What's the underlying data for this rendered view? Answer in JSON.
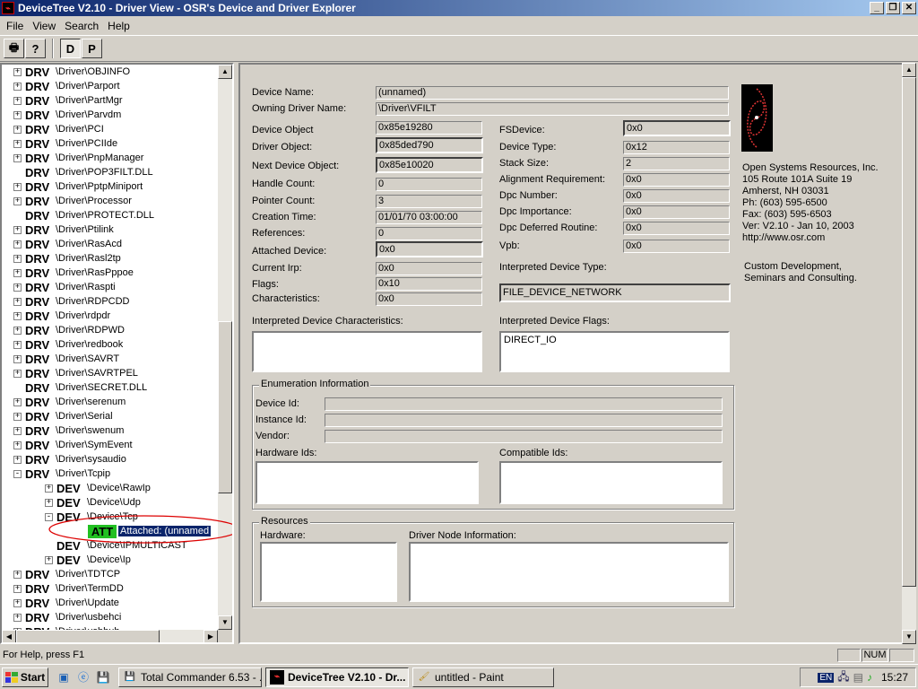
{
  "window": {
    "title": "DeviceTree V2.10 - Driver View - OSR's Device and Driver Explorer"
  },
  "menu": [
    "File",
    "View",
    "Search",
    "Help"
  ],
  "toolbar": {
    "d_label": "D",
    "p_label": "P"
  },
  "tree": {
    "items": [
      {
        "tag": "DRV",
        "name": "\\Driver\\OBJINFO",
        "indent": 0,
        "exp": "+"
      },
      {
        "tag": "DRV",
        "name": "\\Driver\\Parport",
        "indent": 0,
        "exp": "+"
      },
      {
        "tag": "DRV",
        "name": "\\Driver\\PartMgr",
        "indent": 0,
        "exp": "+"
      },
      {
        "tag": "DRV",
        "name": "\\Driver\\Parvdm",
        "indent": 0,
        "exp": "+"
      },
      {
        "tag": "DRV",
        "name": "\\Driver\\PCI",
        "indent": 0,
        "exp": "+"
      },
      {
        "tag": "DRV",
        "name": "\\Driver\\PCIIde",
        "indent": 0,
        "exp": "+"
      },
      {
        "tag": "DRV",
        "name": "\\Driver\\PnpManager",
        "indent": 0,
        "exp": "+"
      },
      {
        "tag": "DRV",
        "name": "\\Driver\\POP3FILT.DLL",
        "indent": 0,
        "exp": ""
      },
      {
        "tag": "DRV",
        "name": "\\Driver\\PptpMiniport",
        "indent": 0,
        "exp": "+"
      },
      {
        "tag": "DRV",
        "name": "\\Driver\\Processor",
        "indent": 0,
        "exp": "+"
      },
      {
        "tag": "DRV",
        "name": "\\Driver\\PROTECT.DLL",
        "indent": 0,
        "exp": ""
      },
      {
        "tag": "DRV",
        "name": "\\Driver\\Ptilink",
        "indent": 0,
        "exp": "+"
      },
      {
        "tag": "DRV",
        "name": "\\Driver\\RasAcd",
        "indent": 0,
        "exp": "+"
      },
      {
        "tag": "DRV",
        "name": "\\Driver\\Rasl2tp",
        "indent": 0,
        "exp": "+"
      },
      {
        "tag": "DRV",
        "name": "\\Driver\\RasPppoe",
        "indent": 0,
        "exp": "+"
      },
      {
        "tag": "DRV",
        "name": "\\Driver\\Raspti",
        "indent": 0,
        "exp": "+"
      },
      {
        "tag": "DRV",
        "name": "\\Driver\\RDPCDD",
        "indent": 0,
        "exp": "+"
      },
      {
        "tag": "DRV",
        "name": "\\Driver\\rdpdr",
        "indent": 0,
        "exp": "+"
      },
      {
        "tag": "DRV",
        "name": "\\Driver\\RDPWD",
        "indent": 0,
        "exp": "+"
      },
      {
        "tag": "DRV",
        "name": "\\Driver\\redbook",
        "indent": 0,
        "exp": "+"
      },
      {
        "tag": "DRV",
        "name": "\\Driver\\SAVRT",
        "indent": 0,
        "exp": "+"
      },
      {
        "tag": "DRV",
        "name": "\\Driver\\SAVRTPEL",
        "indent": 0,
        "exp": "+"
      },
      {
        "tag": "DRV",
        "name": "\\Driver\\SECRET.DLL",
        "indent": 0,
        "exp": ""
      },
      {
        "tag": "DRV",
        "name": "\\Driver\\serenum",
        "indent": 0,
        "exp": "+"
      },
      {
        "tag": "DRV",
        "name": "\\Driver\\Serial",
        "indent": 0,
        "exp": "+"
      },
      {
        "tag": "DRV",
        "name": "\\Driver\\swenum",
        "indent": 0,
        "exp": "+"
      },
      {
        "tag": "DRV",
        "name": "\\Driver\\SymEvent",
        "indent": 0,
        "exp": "+"
      },
      {
        "tag": "DRV",
        "name": "\\Driver\\sysaudio",
        "indent": 0,
        "exp": "+"
      },
      {
        "tag": "DRV",
        "name": "\\Driver\\Tcpip",
        "indent": 0,
        "exp": "-"
      },
      {
        "tag": "DEV",
        "name": "\\Device\\RawIp",
        "indent": 1,
        "exp": "+"
      },
      {
        "tag": "DEV",
        "name": "\\Device\\Udp",
        "indent": 1,
        "exp": "+"
      },
      {
        "tag": "DEV",
        "name": "\\Device\\Tcp",
        "indent": 1,
        "exp": "-"
      },
      {
        "tag": "ATT",
        "name": "Attached: (unnamed",
        "indent": 2,
        "exp": "",
        "selected": true
      },
      {
        "tag": "DEV",
        "name": "\\Device\\IPMULTICAST",
        "indent": 1,
        "exp": ""
      },
      {
        "tag": "DEV",
        "name": "\\Device\\Ip",
        "indent": 1,
        "exp": "+"
      },
      {
        "tag": "DRV",
        "name": "\\Driver\\TDTCP",
        "indent": 0,
        "exp": "+"
      },
      {
        "tag": "DRV",
        "name": "\\Driver\\TermDD",
        "indent": 0,
        "exp": "+"
      },
      {
        "tag": "DRV",
        "name": "\\Driver\\Update",
        "indent": 0,
        "exp": "+"
      },
      {
        "tag": "DRV",
        "name": "\\Driver\\usbehci",
        "indent": 0,
        "exp": "+"
      },
      {
        "tag": "DRV",
        "name": "\\Driver\\usbhub",
        "indent": 0,
        "exp": "+"
      }
    ]
  },
  "details": {
    "device_name_label": "Device Name:",
    "device_name": "(unnamed)",
    "owning_driver_label": "Owning Driver Name:",
    "owning_driver": "\\Driver\\VFILT",
    "device_object_label": "Device Object",
    "device_object": "0x85e19280",
    "driver_object_label": "Driver Object:",
    "driver_object": "0x85ded790",
    "next_device_label": "Next Device Object:",
    "next_device": "0x85e10020",
    "handle_count_label": "Handle Count:",
    "handle_count": "0",
    "pointer_count_label": "Pointer Count:",
    "pointer_count": "3",
    "creation_time_label": "Creation Time:",
    "creation_time": "01/01/70 03:00:00",
    "references_label": "References:",
    "references": "0",
    "attached_device_label": "Attached Device:",
    "attached_device": "0x0",
    "current_irp_label": "Current Irp:",
    "current_irp": "0x0",
    "flags_label": "Flags:",
    "flags": "0x10",
    "characteristics_label": "Characteristics:",
    "characteristics": "0x0",
    "fsdevice_label": "FSDevice:",
    "fsdevice": "0x0",
    "device_type_label": "Device Type:",
    "device_type": "0x12",
    "stack_size_label": "Stack Size:",
    "stack_size": "2",
    "alignment_label": "Alignment Requirement:",
    "alignment": "0x0",
    "dpc_number_label": "Dpc Number:",
    "dpc_number": "0x0",
    "dpc_importance_label": "Dpc Importance:",
    "dpc_importance": "0x0",
    "dpc_deferred_label": "Dpc Deferred Routine:",
    "dpc_deferred": "0x0",
    "vpb_label": "Vpb:",
    "vpb": "0x0",
    "interp_type_label": "Interpreted Device Type:",
    "interp_type": "FILE_DEVICE_NETWORK",
    "interp_chars_label": "Interpreted Device Characteristics:",
    "interp_chars": "",
    "interp_flags_label": "Interpreted Device Flags:",
    "interp_flags": "DIRECT_IO"
  },
  "osr": {
    "lines": [
      "Open Systems Resources, Inc.",
      "105 Route 101A Suite 19",
      "Amherst, NH 03031",
      "Ph:  (603) 595-6500",
      "Fax: (603) 595-6503",
      "Ver: V2.10 -  Jan 10, 2003",
      "http://www.osr.com"
    ],
    "tagline": [
      "Custom Development,",
      "Seminars and Consulting."
    ]
  },
  "enumeration": {
    "title": "Enumeration Information",
    "device_id_label": "Device Id:",
    "instance_id_label": "Instance Id:",
    "vendor_label": "Vendor:",
    "hardware_ids_label": "Hardware Ids:",
    "compatible_ids_label": "Compatible Ids:"
  },
  "resources": {
    "title": "Resources",
    "hardware_label": "Hardware:",
    "driver_node_label": "Driver Node Information:"
  },
  "status": {
    "help": "For Help, press F1",
    "num": "NUM"
  },
  "taskbar": {
    "start": "Start",
    "tasks": [
      "Total Commander 6.53 - ...",
      "DeviceTree V2.10 - Dr...",
      "untitled - Paint"
    ],
    "lang": "EN",
    "clock": "15:27"
  }
}
